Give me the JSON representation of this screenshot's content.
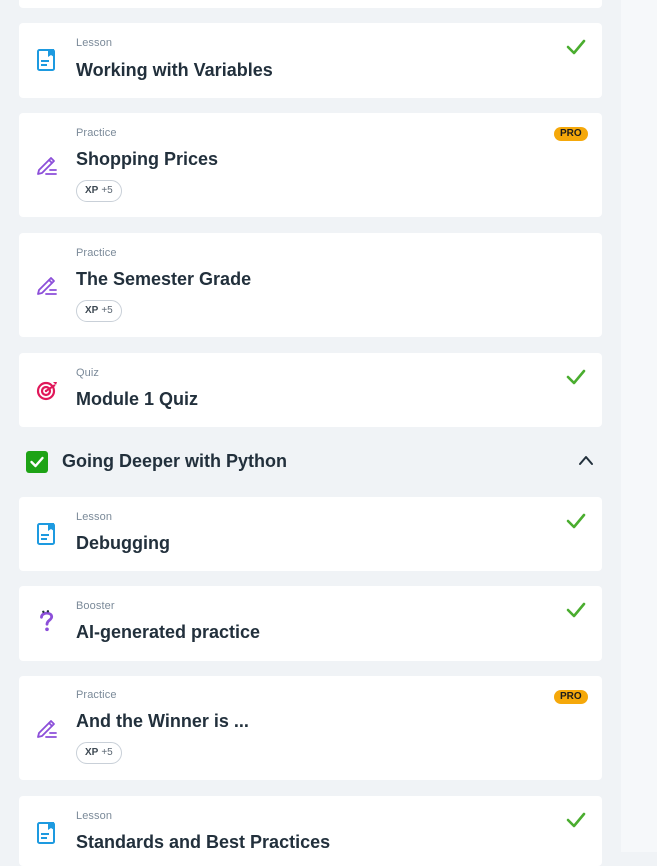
{
  "colors": {
    "page_bg": "#f0f3f6",
    "card_bg": "#ffffff",
    "check_green": "#4aad2f",
    "pro_badge": "#f5a80a",
    "lesson_icon": "#1d9ae0",
    "practice_icon": "#8c4fd9",
    "quiz_icon": "#e0185a",
    "booster_icon": "#8c4fd9",
    "section_check_bg": "#1ea316"
  },
  "items_top": [
    {
      "kind": "Lesson",
      "title": "Working with Variables",
      "icon": "lesson-doc-icon",
      "completed": true
    },
    {
      "kind": "Practice",
      "title": "Shopping Prices",
      "icon": "practice-pencil-icon",
      "badge": "PRO",
      "xp_label": "XP",
      "xp_value": "+5"
    },
    {
      "kind": "Practice",
      "title": "The Semester Grade",
      "icon": "practice-pencil-icon",
      "xp_label": "XP",
      "xp_value": "+5"
    },
    {
      "kind": "Quiz",
      "title": "Module 1 Quiz",
      "icon": "quiz-target-icon",
      "completed": true
    }
  ],
  "section": {
    "title": "Going Deeper with Python",
    "completed": true,
    "expanded": true,
    "icon": "chevron-up-icon"
  },
  "items_bottom": [
    {
      "kind": "Lesson",
      "title": "Debugging",
      "icon": "lesson-doc-icon",
      "completed": true
    },
    {
      "kind": "Booster",
      "title": "AI-generated practice",
      "icon": "booster-question-icon",
      "completed": true
    },
    {
      "kind": "Practice",
      "title": "And the Winner is ...",
      "icon": "practice-pencil-icon",
      "badge": "PRO",
      "xp_label": "XP",
      "xp_value": "+5"
    },
    {
      "kind": "Lesson",
      "title": "Standards and Best Practices",
      "icon": "lesson-doc-icon",
      "completed": true
    }
  ]
}
